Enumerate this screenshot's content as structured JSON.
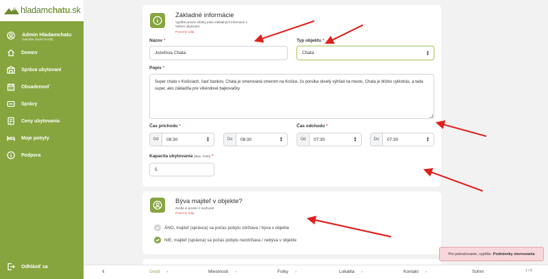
{
  "logo": {
    "part1": "hladam",
    "part2": "chatu",
    "part3": ".sk"
  },
  "user": {
    "name": "Admin Hladamchatu",
    "sub": "(Nemáte žiadne kredit)"
  },
  "nav": {
    "domov": "Domov",
    "sprava": "Správa ubytovaní",
    "obsadenost": "Obsadenosť",
    "spravy": "Správy",
    "ceny": "Ceny ubytovania",
    "pobyty": "Moje pobyty",
    "podpora": "Podpora",
    "logout": "Odhlásiť sa"
  },
  "section1": {
    "title": "Základné informácie",
    "subtitle_line1": "Vyplňte prosím všetky polia základných informácií o",
    "subtitle_line2": "Vašom ubytovaní.",
    "required": "Povinný údaj"
  },
  "form": {
    "nazov_label": "Názov",
    "nazov_value": "Jozefova Chata",
    "typ_label": "Typ objektu",
    "typ_value": "Chata",
    "popis_label": "Popis",
    "popis_value": "Super chata v Košiciach, časť bankov, Chata je smerovaná smerom na Košice, čo ponúka skvelý výhľad na mesto, Chata je blízko cyklotrás, a teda super, ako základňa pre víkendové bajkovačky",
    "prichod_label": "Čas príchodu",
    "odchod_label": "Čas odchodu",
    "od_prefix": "Od",
    "do_prefix": "Do",
    "prichod_od": "08:30",
    "prichod_do": "08:30",
    "odchod_od": "07:30",
    "odchod_do": "07:30",
    "kapacita_label": "Kapacita ubytovania",
    "kapacita_hint": "(Max. hostí)",
    "kapacita_value": "5",
    "star": "*"
  },
  "section2": {
    "title": "Býva majiteľ v objekte?",
    "subtitle": "Zvoľte si prosím z možností",
    "required": "Povinný údaj",
    "option_yes": "ÁNO, majiteľ (správca) sa počas pobytu zdržiava / býva v objekte",
    "option_no": "NIE, majiteľ (správca) sa počas pobytu nezdržiava / nebýva v objekte"
  },
  "steps": {
    "back": "‹",
    "uvod": "Úvod",
    "miestnosti": "Miestnosti",
    "fotky": "Fotky",
    "lokalita": "Lokalita",
    "kontakt": "Kontakt",
    "suhrn": "Súhrn",
    "chev": "›",
    "page": "1 / 6"
  },
  "toast": {
    "text": "Pre pokračovanie, vyplňte:",
    "strong": "Podmienky stornovania"
  },
  "colors": {
    "accent": "#86a53f",
    "required": "#d9534f",
    "arrow": "#e0201c",
    "toast_bg": "#f8d7da"
  }
}
